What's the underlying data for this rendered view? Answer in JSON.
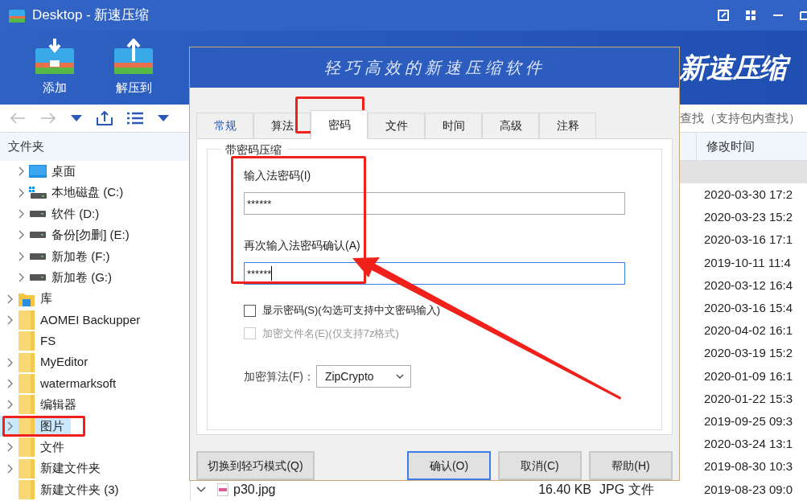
{
  "window": {
    "title": "Desktop - 新速压缩"
  },
  "toolbar": {
    "buttons": [
      {
        "label": "添加",
        "kind": "add"
      },
      {
        "label": "解压到",
        "kind": "extract"
      }
    ],
    "brand": "新速压缩"
  },
  "search": {
    "placeholder": "查找（支持包内查找）"
  },
  "sidebar": {
    "title": "文件夹",
    "items": [
      {
        "children": [
          {
            "label": "桌面",
            "kind": "desktop",
            "selected": false
          },
          {
            "label": "本地磁盘 (C:)",
            "kind": "system-drive",
            "selected": false
          },
          {
            "label": "软件 (D:)",
            "kind": "drive",
            "selected": false
          },
          {
            "label": "备份[勿删] (E:)",
            "kind": "drive",
            "selected": false
          },
          {
            "label": "新加卷 (F:)",
            "kind": "drive",
            "selected": false
          },
          {
            "label": "新加卷 (G:)",
            "kind": "drive",
            "selected": false
          }
        ]
      },
      {
        "label": "库",
        "kind": "library",
        "selected": false,
        "expandable": true
      },
      {
        "label": "AOMEI Backupper",
        "kind": "folder",
        "selected": false,
        "expandable": true
      },
      {
        "label": "FS",
        "kind": "folder",
        "selected": false,
        "expandable": false
      },
      {
        "label": "MyEditor",
        "kind": "folder",
        "selected": false,
        "expandable": true
      },
      {
        "label": "watermarksoft",
        "kind": "folder",
        "selected": false,
        "expandable": true
      },
      {
        "label": "编辑器",
        "kind": "folder",
        "selected": false,
        "expandable": true
      },
      {
        "label": "图片",
        "kind": "folder",
        "selected": true,
        "expandable": true
      },
      {
        "label": "文件",
        "kind": "folder",
        "selected": false,
        "expandable": true
      },
      {
        "label": "新建文件夹",
        "kind": "folder",
        "selected": false,
        "expandable": true
      },
      {
        "label": "新建文件夹 (3)",
        "kind": "folder",
        "selected": false,
        "expandable": false
      }
    ]
  },
  "file_list": {
    "columns": [
      "修改时间"
    ],
    "rows": [
      {
        "selected": true
      },
      {
        "modified": "2020-03-30 17:2",
        "selected": false
      },
      {
        "modified": "2020-03-23 15:2",
        "selected": false
      },
      {
        "modified": "2020-03-16 17:1",
        "selected": false
      },
      {
        "modified": "2019-10-11 11:4",
        "selected": false
      },
      {
        "modified": "2020-03-12 16:4",
        "selected": false
      },
      {
        "modified": "2020-03-16 15:4",
        "selected": false
      },
      {
        "modified": "2020-04-02 16:1",
        "selected": false
      },
      {
        "modified": "2020-03-19 15:2",
        "selected": false
      },
      {
        "modified": "2020-01-09 16:1",
        "selected": false
      },
      {
        "modified": "2020-01-22 15:3",
        "selected": false
      },
      {
        "modified": "2019-09-25 09:3",
        "selected": false
      },
      {
        "modified": "2020-03-24 13:1",
        "selected": false
      },
      {
        "modified": "2019-08-30 10:3",
        "selected": false
      },
      {
        "name": "p30.jpg",
        "size": "16.40 KB",
        "type": "JPG 文件",
        "modified": "2019-08-23 09:0",
        "selected": false
      }
    ]
  },
  "dialog": {
    "title": "轻巧高效的新速压缩软件",
    "tabs": [
      {
        "label": "常规",
        "selected": false,
        "hovered": true
      },
      {
        "label": "算法",
        "selected": false,
        "hovered": false
      },
      {
        "label": "密码",
        "selected": true,
        "hovered": false
      },
      {
        "label": "文件",
        "selected": false,
        "hovered": false
      },
      {
        "label": "时间",
        "selected": false,
        "hovered": false
      },
      {
        "label": "高级",
        "selected": false,
        "hovered": false
      },
      {
        "label": "注释",
        "selected": false,
        "hovered": false
      }
    ],
    "group_title": "带密码压缩",
    "password_label": "输入法密码(I)",
    "password_value": "******",
    "confirm_label": "再次输入法密码确认(A)",
    "confirm_value": "******",
    "confirm_focused": true,
    "checkboxes": [
      {
        "label": "显示密码(S)(勾选可支持中文密码输入)",
        "checked": false,
        "disabled": false
      },
      {
        "label": "加密文件名(E)(仅支持7z格式)",
        "checked": false,
        "disabled": true
      }
    ],
    "algorithm_label": "加密算法(F)：",
    "algorithm_value": "ZipCrypto",
    "buttons": [
      {
        "label": "切换到轻巧模式(Q)",
        "default": false
      },
      {
        "label": "确认(O)",
        "default": true
      },
      {
        "label": "取消(C)",
        "default": false
      },
      {
        "label": "帮助(H)",
        "default": false
      }
    ]
  }
}
